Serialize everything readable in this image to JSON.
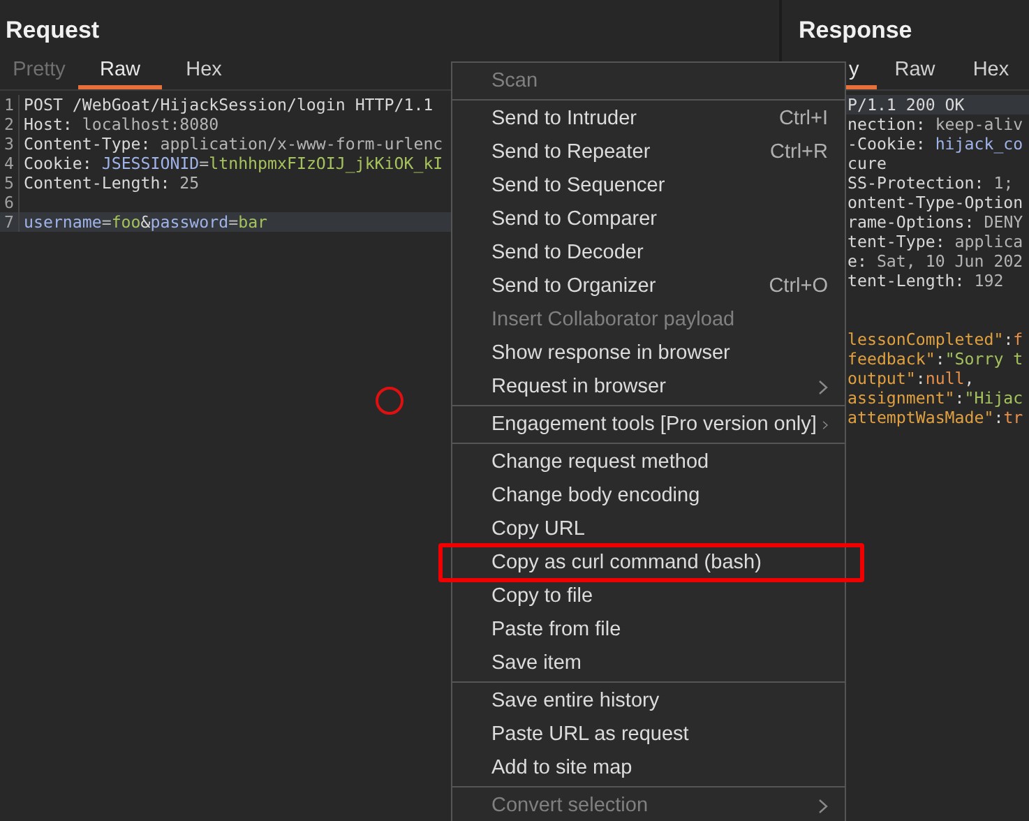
{
  "request": {
    "title": "Request",
    "tabs": [
      {
        "label": "Pretty",
        "selected": false,
        "disabled": true
      },
      {
        "label": "Raw",
        "selected": true,
        "disabled": false
      },
      {
        "label": "Hex",
        "selected": false,
        "disabled": false
      }
    ],
    "lines": [
      {
        "number": "1",
        "current": false,
        "parts": [
          {
            "t": "POST /WebGoat/HijackSession/login HTTP/1.1",
            "color": "#d8d8d8"
          }
        ]
      },
      {
        "number": "2",
        "current": false,
        "parts": [
          {
            "t": "Host:",
            "color": "#d8d8d8"
          },
          {
            "t": " localhost:8080",
            "color": "#b4b4b4"
          }
        ]
      },
      {
        "number": "3",
        "current": false,
        "parts": [
          {
            "t": "Content-Type:",
            "color": "#d8d8d8"
          },
          {
            "t": " application/x-www-form-urlenc",
            "color": "#b4b4b4"
          }
        ]
      },
      {
        "number": "4",
        "current": false,
        "parts": [
          {
            "t": "Cookie:",
            "color": "#d8d8d8"
          },
          {
            "t": " JSESSIONID",
            "color": "#9fb3e8"
          },
          {
            "t": "=",
            "color": "#b4b4b4"
          },
          {
            "t": "ltnhhpmxFIzOIJ_jkKiOK_kI",
            "color": "#a5c25c"
          }
        ]
      },
      {
        "number": "5",
        "current": false,
        "parts": [
          {
            "t": "Content-Length:",
            "color": "#d8d8d8"
          },
          {
            "t": " 25",
            "color": "#b4b4b4"
          }
        ]
      },
      {
        "number": "6",
        "current": false
      },
      {
        "number": "7",
        "current": true,
        "parts": [
          {
            "t": "username",
            "color": "#9fb3e8"
          },
          {
            "t": "=",
            "color": "#b4b4b4"
          },
          {
            "t": "foo",
            "color": "#a5c25c"
          },
          {
            "t": "&",
            "color": "#d8d8d8"
          },
          {
            "t": "password",
            "color": "#9fb3e8"
          },
          {
            "t": "=",
            "color": "#b4b4b4"
          },
          {
            "t": "bar",
            "color": "#a5c25c"
          }
        ]
      }
    ]
  },
  "response": {
    "title": "Response",
    "tabs": [
      {
        "label": "y",
        "selected": true,
        "disabled": false
      },
      {
        "label": "Raw",
        "selected": false,
        "disabled": false
      },
      {
        "label": "Hex",
        "selected": false,
        "disabled": false
      }
    ],
    "lines": [
      {
        "current": true,
        "parts": [
          {
            "t": "P/1.1 200 OK",
            "color": "#d8d8d8"
          }
        ]
      },
      {
        "current": false,
        "parts": [
          {
            "t": "nection:",
            "color": "#d8d8d8"
          },
          {
            "t": " keep-aliv",
            "color": "#b4b4b4"
          }
        ]
      },
      {
        "current": false,
        "parts": [
          {
            "t": "-Cookie:",
            "color": "#d8d8d8"
          },
          {
            "t": " hijack_co",
            "color": "#9fb3e8"
          }
        ]
      },
      {
        "current": false,
        "parts": [
          {
            "t": "cure",
            "color": "#d8d8d8"
          }
        ]
      },
      {
        "current": false,
        "parts": [
          {
            "t": "SS-Protection:",
            "color": "#d8d8d8"
          },
          {
            "t": " 1;",
            "color": "#b4b4b4"
          }
        ]
      },
      {
        "current": false,
        "parts": [
          {
            "t": "ontent-Type-Option",
            "color": "#d8d8d8"
          }
        ]
      },
      {
        "current": false,
        "parts": [
          {
            "t": "rame-Options:",
            "color": "#d8d8d8"
          },
          {
            "t": " DENY",
            "color": "#b4b4b4"
          }
        ]
      },
      {
        "current": false,
        "parts": [
          {
            "t": "tent-Type:",
            "color": "#d8d8d8"
          },
          {
            "t": " applica",
            "color": "#b4b4b4"
          }
        ]
      },
      {
        "current": false,
        "parts": [
          {
            "t": "e:",
            "color": "#d8d8d8"
          },
          {
            "t": " Sat, 10 Jun 202",
            "color": "#b4b4b4"
          }
        ]
      },
      {
        "current": false,
        "parts": [
          {
            "t": "tent-Length:",
            "color": "#d8d8d8"
          },
          {
            "t": " 192",
            "color": "#b4b4b4"
          }
        ]
      },
      {
        "current": false
      },
      {
        "current": false
      },
      {
        "current": false,
        "parts": [
          {
            "t": "lessonCompleted\"",
            "color": "#e0a040"
          },
          {
            "t": ":",
            "color": "#d8d8d8"
          },
          {
            "t": "f",
            "color": "#e8904a"
          }
        ]
      },
      {
        "current": false,
        "parts": [
          {
            "t": "feedback\"",
            "color": "#e0a040"
          },
          {
            "t": ":",
            "color": "#d8d8d8"
          },
          {
            "t": "\"Sorry t",
            "color": "#a5c25c"
          }
        ]
      },
      {
        "current": false,
        "parts": [
          {
            "t": "output\"",
            "color": "#e0a040"
          },
          {
            "t": ":",
            "color": "#d8d8d8"
          },
          {
            "t": "null",
            "color": "#e8904a"
          },
          {
            "t": ",",
            "color": "#d8d8d8"
          }
        ]
      },
      {
        "current": false,
        "parts": [
          {
            "t": "assignment\"",
            "color": "#e0a040"
          },
          {
            "t": ":",
            "color": "#d8d8d8"
          },
          {
            "t": "\"Hijac",
            "color": "#a5c25c"
          }
        ]
      },
      {
        "current": false,
        "parts": [
          {
            "t": "attemptWasMade\"",
            "color": "#e0a040"
          },
          {
            "t": ":",
            "color": "#d8d8d8"
          },
          {
            "t": "tr",
            "color": "#e8904a"
          }
        ]
      }
    ]
  },
  "context_menu": {
    "groups": [
      {
        "items": [
          {
            "label": "Scan",
            "disabled": true,
            "submenu": false,
            "boxed": false
          }
        ]
      },
      {
        "items": [
          {
            "label": "Send to Intruder",
            "shortcut": "Ctrl+I",
            "disabled": false,
            "submenu": false,
            "boxed": false
          },
          {
            "label": "Send to Repeater",
            "shortcut": "Ctrl+R",
            "disabled": false,
            "submenu": false,
            "boxed": false
          },
          {
            "label": "Send to Sequencer",
            "disabled": false,
            "submenu": false,
            "boxed": false
          },
          {
            "label": "Send to Comparer",
            "disabled": false,
            "submenu": false,
            "boxed": false
          },
          {
            "label": "Send to Decoder",
            "disabled": false,
            "submenu": false,
            "boxed": false
          },
          {
            "label": "Send to Organizer",
            "shortcut": "Ctrl+O",
            "disabled": false,
            "submenu": false,
            "boxed": false
          },
          {
            "label": "Insert Collaborator payload",
            "disabled": true,
            "submenu": false,
            "boxed": false
          },
          {
            "label": "Show response in browser",
            "disabled": false,
            "submenu": false,
            "boxed": false
          },
          {
            "label": "Request in browser",
            "disabled": false,
            "submenu": true,
            "boxed": false
          }
        ]
      },
      {
        "items": [
          {
            "label": "Engagement tools [Pro version only]",
            "disabled": false,
            "submenu": true,
            "boxed": false
          }
        ]
      },
      {
        "items": [
          {
            "label": "Change request method",
            "disabled": false,
            "submenu": false,
            "boxed": false
          },
          {
            "label": "Change body encoding",
            "disabled": false,
            "submenu": false,
            "boxed": false
          },
          {
            "label": "Copy URL",
            "disabled": false,
            "submenu": false,
            "boxed": false
          },
          {
            "label": "Copy as curl command (bash)",
            "disabled": false,
            "submenu": false,
            "boxed": true
          },
          {
            "label": "Copy to file",
            "disabled": false,
            "submenu": false,
            "boxed": false
          },
          {
            "label": "Paste from file",
            "disabled": false,
            "submenu": false,
            "boxed": false
          },
          {
            "label": "Save item",
            "disabled": false,
            "submenu": false,
            "boxed": false
          }
        ]
      },
      {
        "items": [
          {
            "label": "Save entire history",
            "disabled": false,
            "submenu": false,
            "boxed": false
          },
          {
            "label": "Paste URL as request",
            "disabled": false,
            "submenu": false,
            "boxed": false
          },
          {
            "label": "Add to site map",
            "disabled": false,
            "submenu": false,
            "boxed": false
          }
        ]
      },
      {
        "items": [
          {
            "label": "Convert selection",
            "disabled": true,
            "submenu": true,
            "boxed": false
          }
        ]
      }
    ]
  }
}
